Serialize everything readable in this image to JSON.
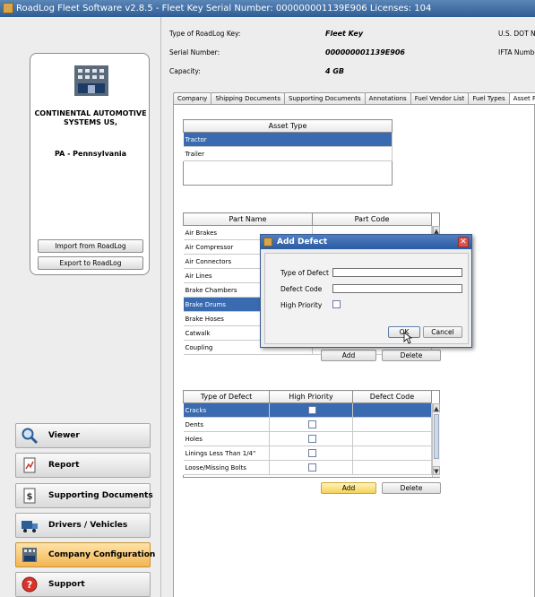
{
  "window": {
    "title": "RoadLog Fleet Software v2.8.5 - Fleet Key Serial Number: 000000001139E906 Licenses: 104"
  },
  "company": {
    "name": "CONTINENTAL AUTOMOTIVE SYSTEMS US,",
    "state": "PA - Pennsylvania",
    "import_label": "Import from RoadLog",
    "export_label": "Export to RoadLog"
  },
  "nav": {
    "viewer": "Viewer",
    "report": "Report",
    "supporting_documents": "Supporting Documents",
    "drivers_vehicles": "Drivers / Vehicles",
    "company_configuration": "Company Configuration",
    "support": "Support"
  },
  "info": {
    "key_type_label": "Type of RoadLog Key:",
    "key_type_value": "Fleet Key",
    "serial_label": "Serial Number:",
    "serial_value": "000000001139E906",
    "capacity_label": "Capacity:",
    "capacity_value": "4 GB",
    "dot_label": "U.S. DOT Nu",
    "ifta_label": "IFTA Numbe"
  },
  "tabs": [
    "Company",
    "Shipping Documents",
    "Supporting Documents",
    "Annotations",
    "Fuel Vendor List",
    "Fuel Types",
    "Asset Part"
  ],
  "asset_table": {
    "header": "Asset Type",
    "rows": [
      "Tractor",
      "Trailer"
    ]
  },
  "part_table": {
    "headers": [
      "Part Name",
      "Part Code"
    ],
    "rows": [
      "Air Brakes",
      "Air Compressor",
      "Air Connectors",
      "Air Lines",
      "Brake Chambers",
      "Brake Drums",
      "Brake Hoses",
      "Catwalk",
      "Coupling"
    ],
    "add_label": "Add",
    "delete_label": "Delete"
  },
  "defect_table": {
    "headers": [
      "Type of Defect",
      "High Priority",
      "Defect Code"
    ],
    "rows": [
      "Cracks",
      "Dents",
      "Holes",
      "Linings Less Than 1/4\"",
      "Loose/Missing Bolts"
    ],
    "add_label": "Add",
    "delete_label": "Delete"
  },
  "dialog": {
    "title": "Add Defect",
    "type_label": "Type of Defect",
    "code_label": "Defect Code",
    "priority_label": "High Priority",
    "ok_label": "OK",
    "cancel_label": "Cancel"
  }
}
